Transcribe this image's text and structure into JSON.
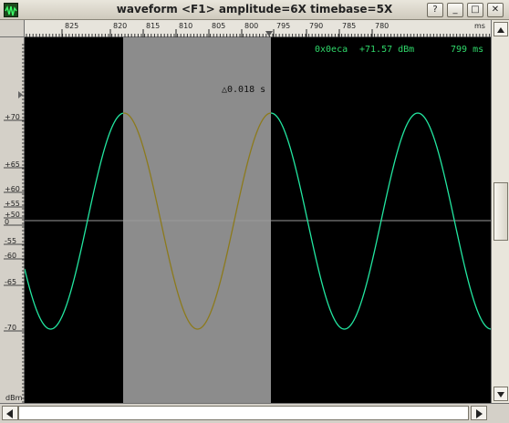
{
  "window": {
    "title": "waveform  <F1> amplitude=6X timebase=5X",
    "buttons": {
      "help": "?",
      "minimize": "_",
      "maximize": "□",
      "close": "✕"
    }
  },
  "ruler": {
    "ticks": [
      "825",
      "820",
      "815",
      "810",
      "805",
      "800",
      "795",
      "790",
      "785",
      "780"
    ],
    "unit": "ms"
  },
  "yaxis": {
    "labels": [
      "+70",
      "+65",
      "+60",
      "+55",
      "+50",
      "0",
      "-55",
      "-60",
      "-65",
      "-70"
    ],
    "unit": "dBm"
  },
  "readout": {
    "address": "0x0eca",
    "power": "+71.57 dBm",
    "time": "799 ms",
    "delta": "△0.018 s"
  },
  "colors": {
    "plot_bg": "#000000",
    "trace": "#22e6a0",
    "trace_selected": "#8c7a1c",
    "selection": "#8c8c8c",
    "readout_text": "#2fd86a",
    "zero_line": "#9a9a9a"
  },
  "icons": {
    "app": "waveform-app-icon",
    "help": "help-icon",
    "minimize": "minimize-icon",
    "maximize": "maximize-icon",
    "close": "close-icon",
    "cursor_marker": "triangle-cursor-icon",
    "scroll_up": "arrow-up-icon",
    "scroll_down": "arrow-down-icon",
    "scroll_left": "arrow-left-icon",
    "scroll_right": "arrow-right-icon"
  }
}
